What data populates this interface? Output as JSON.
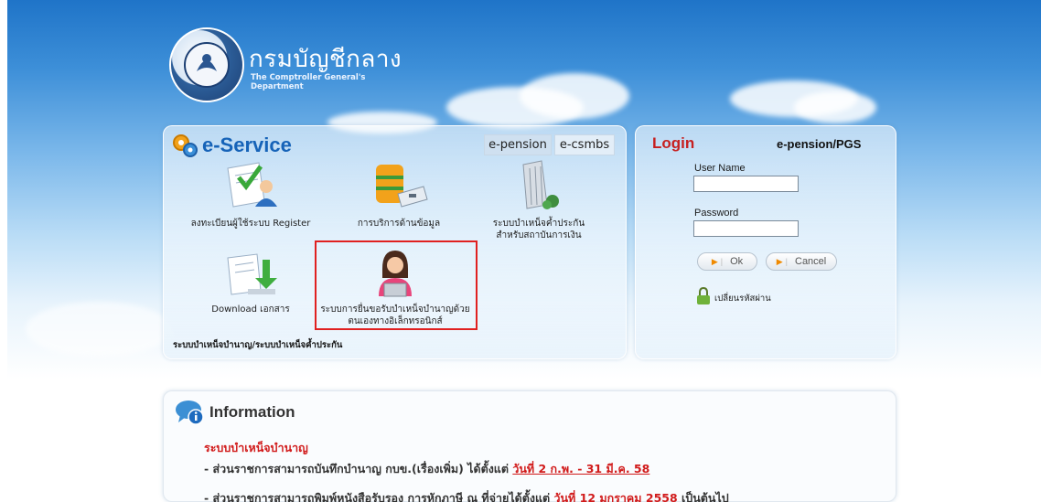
{
  "header": {
    "title_th": "กรมบัญชีกลาง",
    "title_en": "The Comptroller General's Department"
  },
  "eservice": {
    "title": "e-Service",
    "tabs": [
      {
        "label": "e-pension"
      },
      {
        "label": "e-csmbs"
      }
    ],
    "services": [
      {
        "label": "ลงทะเบียนผู้ใช้ระบบ Register",
        "icon": "register-icon"
      },
      {
        "label": "การบริการด้านข้อมูล",
        "icon": "database-icon"
      },
      {
        "label": "ระบบบำเหน็จค้ำประกัน สำหรับสถาบันการเงิน",
        "icon": "building-icon"
      },
      {
        "label": "Download เอกสาร",
        "icon": "download-icon"
      },
      {
        "label": "ระบบการยื่นขอรับบำเหน็จบำนาญด้วยตนเองทางอิเล็กทรอนิกส์",
        "icon": "user-laptop-icon"
      }
    ],
    "footer": "ระบบบำเหน็จบำนาญ/ระบบบำเหน็จค้ำประกัน"
  },
  "login": {
    "title": "Login",
    "subtitle": "e-pension/PGS",
    "username_label": "User Name",
    "username_value": "",
    "password_label": "Password",
    "password_value": "",
    "ok_label": "Ok",
    "cancel_label": "Cancel",
    "change_password": "เปลี่ยนรหัสผ่าน"
  },
  "info": {
    "title": "Information",
    "heading": "ระบบบำเหน็จบำนาญ",
    "line1_text": "- ส่วนราชการสามารถบันทึกบำนาญ กบข.(เรื่องเพิ่ม) ได้ตั้งแต่ ",
    "line1_link": "วันที่ 2 ก.พ. - 31 มี.ค. 58",
    "line2_text": "- ส่วนราชการสามารถพิมพ์หนังสือรับรอง การหักภาษี ณ ที่จ่ายได้ตั้งแต่ ",
    "line2_link": "วันที่ 12 มกราคม 2558 ",
    "line2_tail": "เป็นต้นไป"
  },
  "colors": {
    "accent_blue": "#1663b8",
    "login_red": "#c62020",
    "highlight_red": "#e02020"
  }
}
